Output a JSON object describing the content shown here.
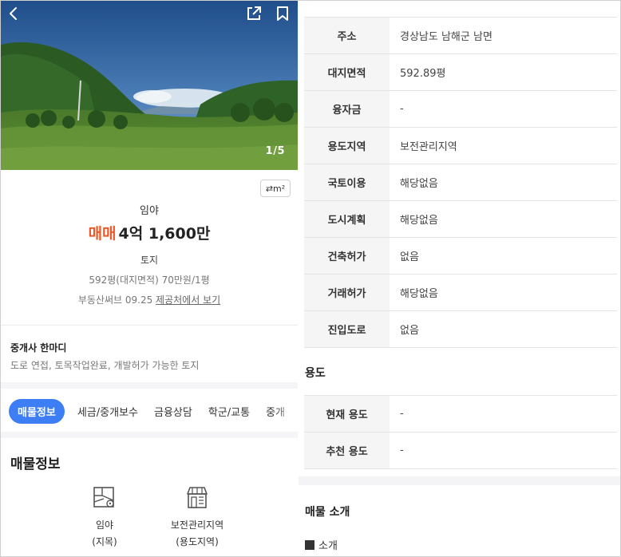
{
  "photo": {
    "counter": "1/5"
  },
  "unit_toggle": {
    "label": "⇄m²"
  },
  "summary": {
    "category": "임야",
    "deal_type": "매매",
    "price": "4억 1,600만",
    "land_type": "토지",
    "area": "592평(대지면적)  70만원/1평",
    "source_prefix": "부동산써브 09.25 ",
    "source_link": "제공처에서 보기"
  },
  "agent": {
    "title": "중개사 한마디",
    "comment": "도로 연접, 토목작업완료, 개발허가 가능한 토지"
  },
  "tabs": [
    {
      "label": "매물정보"
    },
    {
      "label": "세금/중개보수"
    },
    {
      "label": "금융상담"
    },
    {
      "label": "학군/교통"
    },
    {
      "label": "중개"
    }
  ],
  "property_info": {
    "title": "매물정보",
    "features": [
      {
        "icon": "land-map-icon",
        "line1": "임야",
        "line2": "(지목)"
      },
      {
        "icon": "store-building-icon",
        "line1": "보전관리지역",
        "line2": "(용도지역)"
      }
    ]
  },
  "info_table": [
    {
      "label": "주소",
      "value": "경상남도 남해군 남면"
    },
    {
      "label": "대지면적",
      "value": "592.89평"
    },
    {
      "label": "융자금",
      "value": "-"
    },
    {
      "label": "용도지역",
      "value": "보전관리지역"
    },
    {
      "label": "국토이용",
      "value": "해당없음"
    },
    {
      "label": "도시계획",
      "value": "해당없음"
    },
    {
      "label": "건축허가",
      "value": "없음"
    },
    {
      "label": "거래허가",
      "value": "해당없음"
    },
    {
      "label": "진입도로",
      "value": "없음"
    }
  ],
  "usage": {
    "title": "용도",
    "rows": [
      {
        "label": "현재 용도",
        "value": "-"
      },
      {
        "label": "추천 용도",
        "value": "-"
      }
    ]
  },
  "intro": {
    "title": "매물 소개",
    "item": "소개"
  },
  "colors": {
    "accent": "#3d7ef5",
    "deal": "#ea5a2a"
  }
}
